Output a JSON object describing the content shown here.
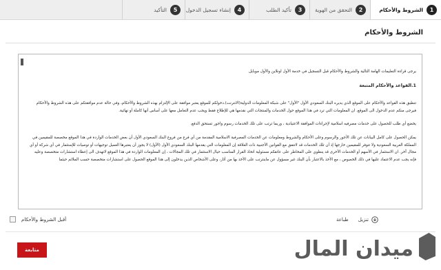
{
  "steps": [
    {
      "num": "1",
      "label": "الشروط والأحكام",
      "active": true
    },
    {
      "num": "2",
      "label": "التحقق من الهوية",
      "active": false
    },
    {
      "num": "3",
      "label": "تأكيد الطلب",
      "active": false
    },
    {
      "num": "4",
      "label": "إنشاء تسجيل الدخول",
      "active": false
    },
    {
      "num": "5",
      "label": "التأكيد",
      "active": false
    }
  ],
  "section_title": "الشروط والأحكام",
  "terms": {
    "p1": "يرجى قراءة التعليمات الهامة التالية والشروط والأحكام قبل التسجيل في خدمة الأول اونلاين والأول موبايل",
    "heading": "1.القواعد والأحكام المتبعة",
    "p2": "تنطبق هذه القواعد والأحكام على الموقع الذي يديره البنك السعودي الأول \"الأول\" على شبكة المعلومات الدولية(الانترنت).دخولكم للموقع يعتبر موافقة على الإلتزام بهذه الشروط والأحكام، وفي حالة عدم موافقتكم على هذه الشروط والأحكام فيرجى منكم عدم الدخول الى الموقع. ان المعلومات التي ترد في هذا الموقع حول الخدمات والمنتجات التي نقدمها هي للإطلاع فقط ويجب عدم التعامل معها على أساس أنها كاملة أو نهائية.",
    "p3": "يخضع أي طلب للحصول على خدمات مصرفيه اسلامية لإجراءات الموافقة الاعتيادية ، وربما ترتب على تلك الخدمات رسوم واجور تستحق الدفع.",
    "p4": "يمكن الحصول على كامل البيانات عن تلك الأجور والرسوم وعلى الأحكام والشروط ومعلومات عن الخدمات المصرفية الاسلامية المقدمة من أي فرع من فروع البنك السعودي الأول أن بعض الخدمات الواردة في هذا الموقع مخصصة للمقيمين في المملكة العربية السعودية ولا تتوفر للمقيمين خارجها إذ أن تلك الخدمات قد لاتتفق مع القوانين الأجنبية ذات العلاقة إن المعلومات التي يقدمها البنك السعودي الأول (الأول) لا يجوز أن يعتبرها العميل توجيهات أو توصيات للإستثمار في أي شركة أو أي مجال آخر. ان الاستثمار في الأسهم أو الخدمات الأخرى قد ينطوي على المخاطر على عاتقكم مسئولية اتخاذ القرار المناسب حيال الاستثمار في تلك المجالات ، إن المعلومات الواردة في هذا الموقع لاتهدف الى إعطاء استشارات متخصصة وعليه فإنه يجب عدم الاعتماد عليها في ذلك الخصوص ، مع الأخذ بالاعتبار بأن البنك غير مسؤول عن ماينترتب على الأخذ بها من أثار، وعلى الأشخاص الذين يدخلون إلى هذا الموقع الحصول على استشارات متخصصة حسب الملائم حيثما"
  },
  "accept_label": "أقبل الشروط والأحكام",
  "tools": {
    "print_label": "طباعة",
    "download_label": "تنزيل"
  },
  "continue_label": "متابعة",
  "watermark_text": "ميدان المال",
  "colors": {
    "accent": "#c7151a",
    "step_bar": "#eeeeee",
    "step_number": "#333333"
  }
}
